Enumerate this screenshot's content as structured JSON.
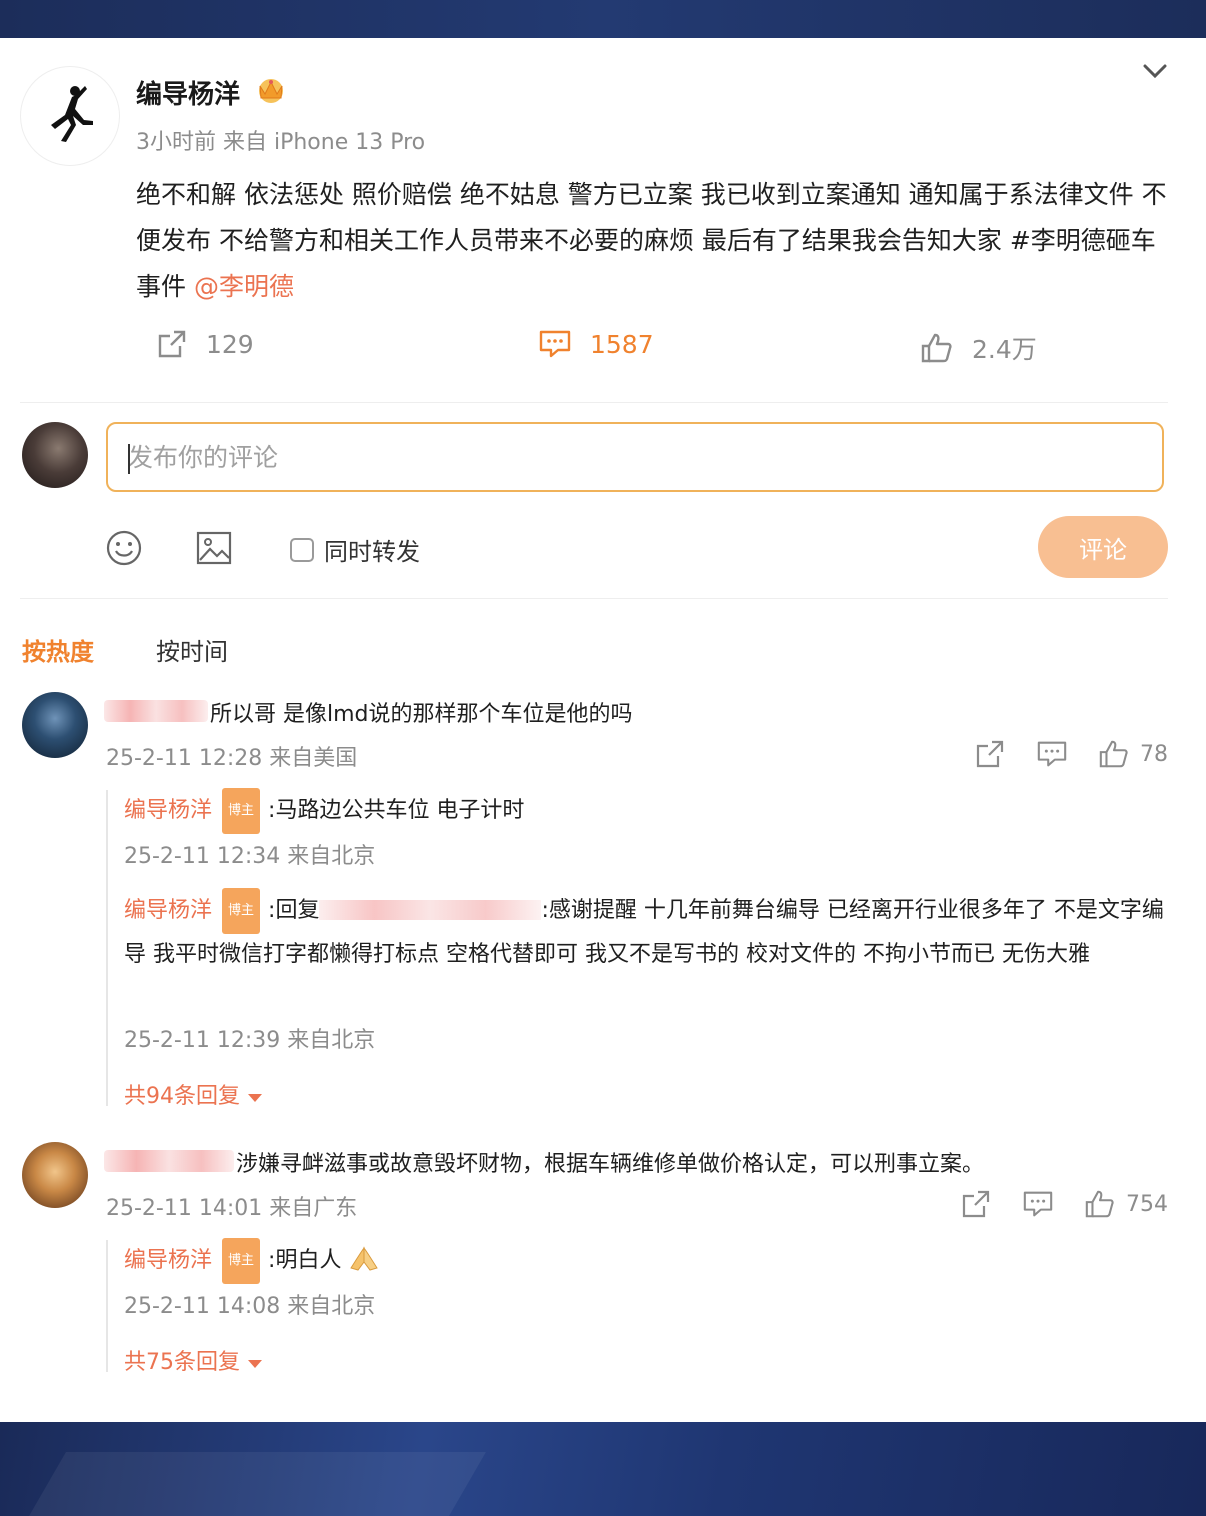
{
  "post": {
    "author": "编导杨洋",
    "meta": "3小时前  来自 iPhone 13 Pro",
    "text": "绝不和解 依法惩处 照价赔偿 绝不姑息 警方已立案 我已收到立案通知 通知属于系法律文件 不便发布 不给警方和相关工作人员带来不必要的麻烦 最后有了结果我会告知大家 #李明德砸车事件 ",
    "mention": "@李明德",
    "reposts": "129",
    "comments": "1587",
    "likes": "2.4万"
  },
  "composer": {
    "placeholder": "发布你的评论",
    "repost_label": "同时转发",
    "submit_label": "评论"
  },
  "sort": {
    "hot": "按热度",
    "time": "按时间"
  },
  "comments": [
    {
      "text": "所以哥 是像lmd说的那样那个车位是他的吗",
      "meta": "25-2-11 12:28 来自美国",
      "likes": "78",
      "replies": [
        {
          "name": "编导杨洋",
          "badge": "博主",
          "text": ":马路边公共车位 电子计时",
          "meta": "25-2-11 12:34 来自北京"
        },
        {
          "name": "编导杨洋",
          "badge": "博主",
          "prefix": ":回复",
          "text": ":感谢提醒 十几年前舞台编导 已经离开行业很多年了 不是文字编导 我平时微信打字都懒得打标点 空格代替即可 我又不是写书的 校对文件的 不拘小节而已 无伤大雅",
          "meta": "25-2-11 12:39 来自北京"
        }
      ],
      "more": "共94条回复"
    },
    {
      "text": "涉嫌寻衅滋事或故意毁坏财物，根据车辆维修单做价格认定，可以刑事立案。",
      "meta": "25-2-11 14:01 来自广东",
      "likes": "754",
      "replies": [
        {
          "name": "编导杨洋",
          "badge": "博主",
          "text": ":明白人",
          "meta": "25-2-11 14:08 来自北京"
        }
      ],
      "more": "共75条回复"
    }
  ],
  "colors": {
    "accent": "#f0822e",
    "link": "#eb7350",
    "button": "#f8bf92",
    "frame": "#1c2d5a"
  }
}
